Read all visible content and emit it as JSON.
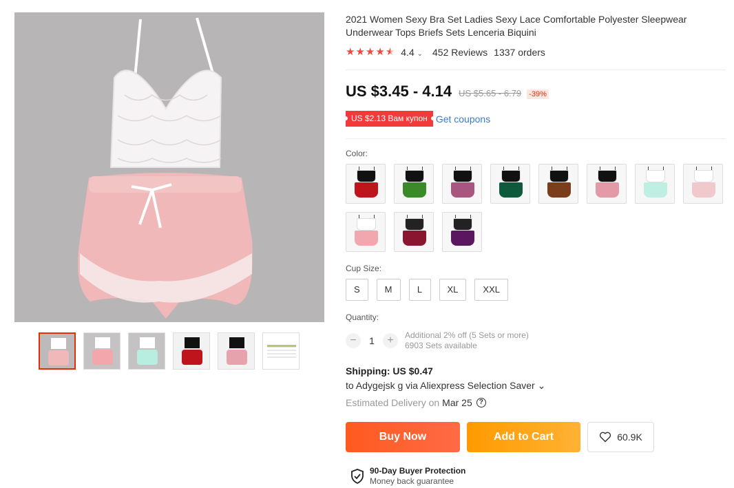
{
  "product": {
    "title": "2021 Women Sexy Bra Set Ladies Sexy Lace Comfortable Polyester Sleepwear Underwear Tops Briefs Sets Lenceria Biquini",
    "rating": "4.4",
    "rating_stars": 4.5,
    "reviews": "452 Reviews",
    "orders": "1337 orders",
    "price": "US $3.45 - 4.14",
    "old_price": "US $5.65 - 6.79",
    "discount": "-39%",
    "coupon": "US $2.13 Вам купон",
    "get_coupons": "Get coupons"
  },
  "colors": {
    "label": "Color:",
    "swatches": [
      {
        "top": "#111111",
        "bottom": "#c0141c"
      },
      {
        "top": "#111111",
        "bottom": "#3b8a2a"
      },
      {
        "top": "#111111",
        "bottom": "#a8557f"
      },
      {
        "top": "#111111",
        "bottom": "#0f5a3c"
      },
      {
        "top": "#111111",
        "bottom": "#7a3e1c"
      },
      {
        "top": "#111111",
        "bottom": "#e39aa6"
      },
      {
        "top": "#ffffff",
        "bottom": "#bfeee2"
      },
      {
        "top": "#ffffff",
        "bottom": "#f1c8cc"
      },
      {
        "top": "#ffffff",
        "bottom": "#f2a7ae"
      },
      {
        "top": "#222222",
        "bottom": "#8a1530"
      },
      {
        "top": "#222222",
        "bottom": "#5b1660"
      }
    ]
  },
  "sizes": {
    "label": "Cup Size:",
    "options": [
      "S",
      "M",
      "L",
      "XL",
      "XXL"
    ]
  },
  "quantity": {
    "label": "Quantity:",
    "value": "1",
    "minus": "−",
    "plus": "+",
    "note1": "Additional 2% off (5 Sets or more)",
    "note2": "6903 Sets available"
  },
  "shipping": {
    "title": "Shipping: US $0.47",
    "destination": "to Adygejsk g via Aliexpress Selection Saver ⌄",
    "estimated_label": "Estimated Delivery on",
    "estimated_date": "Mar 25",
    "help": "?"
  },
  "actions": {
    "buy_now": "Buy Now",
    "add_to_cart": "Add to Cart",
    "wishlist_count": "60.9K"
  },
  "protection": {
    "title": "90-Day Buyer Protection",
    "subtitle": "Money back guarantee"
  },
  "icons": {
    "star": "star-icon",
    "heart": "heart-icon",
    "shield": "shield-check-icon"
  },
  "accent": "#e62e04"
}
